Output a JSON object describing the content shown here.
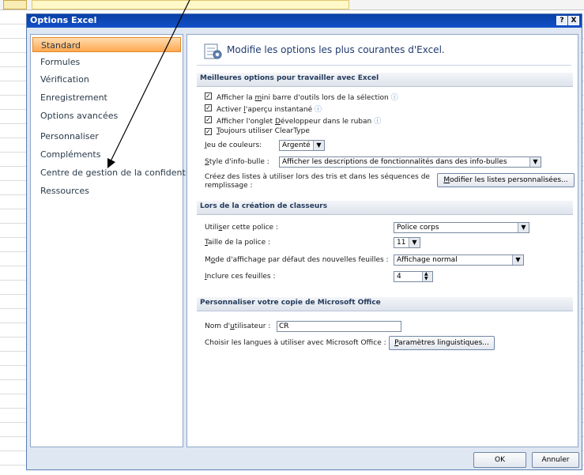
{
  "dialog": {
    "title": "Options Excel",
    "help": "?",
    "close": "X"
  },
  "nav": {
    "items": [
      "Standard",
      "Formules",
      "Vérification",
      "Enregistrement",
      "Options avancées",
      "Personnaliser",
      "Compléments",
      "Centre de gestion de la confidentialité",
      "Ressources"
    ]
  },
  "header": {
    "text": "Modifie les options les plus courantes d'Excel."
  },
  "section1": {
    "title": "Meilleures options pour travailler avec Excel",
    "checks": [
      {
        "pre": "Afficher la ",
        "u": "m",
        "post": "ini barre d'outils lors de la sélection",
        "info": true
      },
      {
        "pre": "Activer ",
        "u": "l",
        "post": "'aperçu instantané",
        "info": true
      },
      {
        "pre": "Afficher l'onglet ",
        "u": "D",
        "post": "éveloppeur dans le ruban",
        "info": true
      },
      {
        "pre": "",
        "u": "T",
        "post": "oujours utiliser ClearType",
        "info": false
      }
    ],
    "color_label_u": "J",
    "color_label_rest": "eu de couleurs:",
    "color_value": "Argenté",
    "tooltip_label_u": "S",
    "tooltip_label_rest": "tyle d'info-bulle :",
    "tooltip_value": "Afficher les descriptions de fonctionnalités dans des info-bulles",
    "lists_text_1": "Créez des listes à utiliser lors des tris et dans les séquences de",
    "lists_text_2": "remplissage :",
    "lists_button_u": "M",
    "lists_button_rest": "odifier les listes personnalisées..."
  },
  "section2": {
    "title": "Lors de la création de classeurs",
    "font_label_pre": "Utili",
    "font_label_u": "s",
    "font_label_post": "er cette police :",
    "font_value": "Police corps",
    "size_label_u": "T",
    "size_label_rest": "aille de la police :",
    "size_value": "11",
    "view_label_pre": "M",
    "view_label_u": "o",
    "view_label_post": "de d'affichage par défaut des nouvelles feuilles :",
    "view_value": "Affichage normal",
    "sheets_label_u": "I",
    "sheets_label_rest": "nclure ces feuilles :",
    "sheets_value": "4"
  },
  "section3": {
    "title": "Personnaliser votre copie de Microsoft Office",
    "user_label_pre": "Nom d'",
    "user_label_u": "u",
    "user_label_post": "tilisateur :",
    "user_value": "CR",
    "lang_label": "Choisir les langues à utiliser avec Microsoft Office :",
    "lang_button_u": "P",
    "lang_button_rest": "aramètres linguistiques..."
  },
  "footer": {
    "ok": "OK",
    "cancel": "Annuler"
  },
  "colors": {
    "selected": "#ffa850",
    "titlebar": "#0a3fa6"
  }
}
